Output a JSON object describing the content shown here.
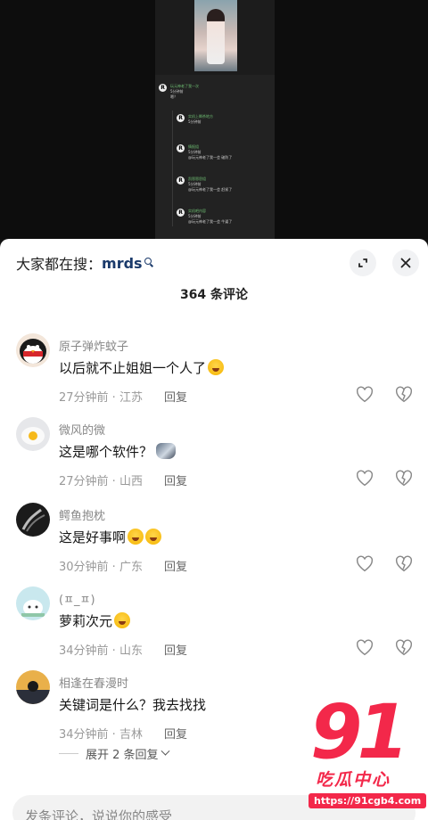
{
  "video": {
    "mini_comments": [
      {
        "name": "玩元神老了我一次",
        "text": "嗯？",
        "time": "5分钟前"
      },
      {
        "name": "实机上瞬杀地方",
        "text": "",
        "time": "5分钟前"
      },
      {
        "name": "情报组",
        "text": "@玩元神老了我一会 破防了",
        "time": "5分钟前"
      },
      {
        "name": "凯恩恩怨组",
        "text": "@玩元神老了我一会 赶紧了",
        "time": "5分钟前"
      },
      {
        "name": "实机吧内容",
        "text": "@玩元神老了我一会 牛逼了",
        "time": "5分钟前"
      }
    ]
  },
  "sheet": {
    "search_label": "大家都在搜：",
    "search_term": "mrds",
    "title": "364 条评论",
    "comments": [
      {
        "name": "原子弹炸蚊子",
        "text": "以后就不止姐姐一个人了",
        "emoji": "laugh-cry",
        "time": "27分钟前",
        "loc": "江苏",
        "reply": "回复"
      },
      {
        "name": "微风的微",
        "text": "这是哪个软件？",
        "emoji": "cat-sticker",
        "time": "27分钟前",
        "loc": "山西",
        "reply": "回复"
      },
      {
        "name": "鳄鱼抱枕",
        "text": "这是好事啊",
        "emoji": "laugh-cry",
        "time": "30分钟前",
        "loc": "广东",
        "reply": "回复"
      },
      {
        "name": "(ㅍ_ㅍ)",
        "text": "萝莉次元",
        "emoji": "laugh-cry",
        "time": "34分钟前",
        "loc": "山东",
        "reply": "回复"
      },
      {
        "name": "相逢在春漫时",
        "text": "关键词是什么？我去找找",
        "emoji": "",
        "time": "34分钟前",
        "loc": "吉林",
        "reply": "回复"
      }
    ],
    "expand_text": "展开 2 条回复",
    "input_placeholder": "发条评论，说说你的感受"
  },
  "watermark": {
    "num": "91",
    "sub": "吃瓜中心",
    "url": "https://91cgb4.com"
  },
  "colors": {
    "accent": "#f3284a",
    "search_term": "#1a3a6b"
  }
}
